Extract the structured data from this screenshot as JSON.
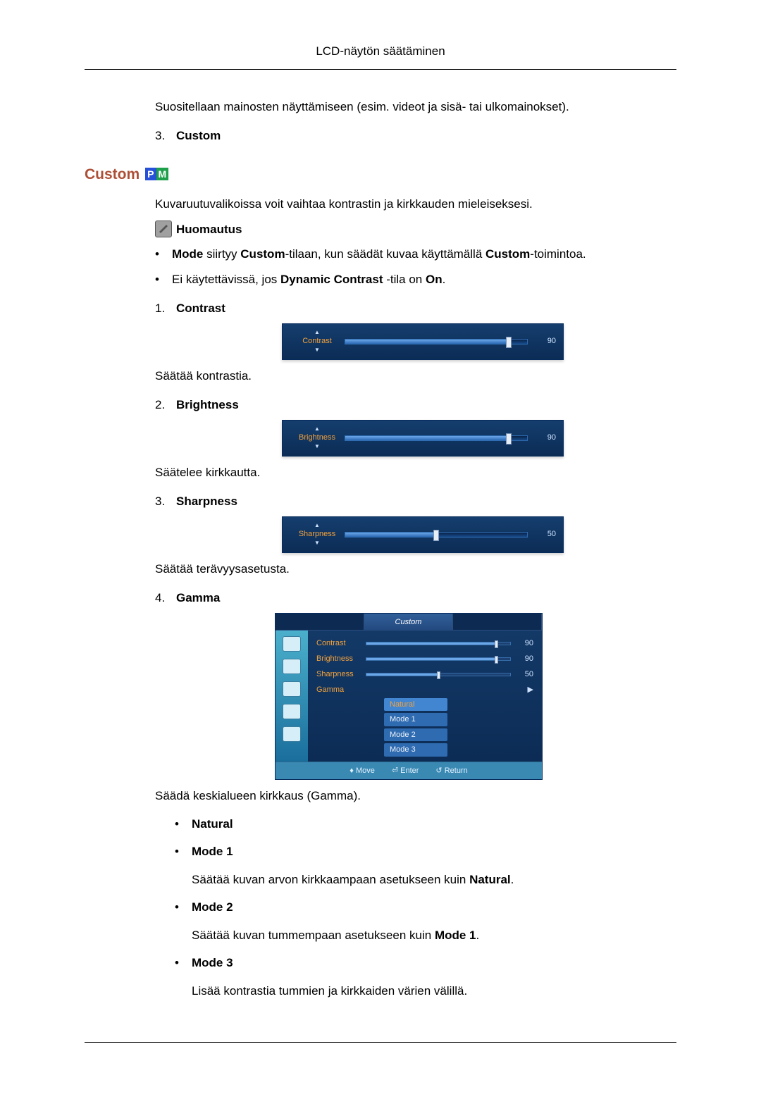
{
  "page_title": "LCD-näytön säätäminen",
  "intro_line": "Suositellaan mainosten näyttämiseen (esim. videot ja sisä- tai ulkomainokset).",
  "item3": {
    "num": "3.",
    "label": "Custom"
  },
  "custom_heading": "Custom",
  "pm": {
    "p": "P",
    "m": "M"
  },
  "custom_intro": "Kuvaruutuvalikoissa voit vaihtaa kontrastin ja kirkkauden mieleiseksesi.",
  "note_label": "Huomautus",
  "note_bullets": [
    {
      "pre": "Mode",
      "mid1": " siirtyy ",
      "b1": "Custom",
      "mid2": "-tilaan, kun säädät kuvaa käyttämällä ",
      "b2": "Custom",
      "post": "-toimintoa."
    },
    {
      "pre": "Ei käytettävissä, jos ",
      "b1": "Dynamic Contrast",
      "mid": " -tila on ",
      "b2": "On",
      "post": "."
    }
  ],
  "contrast": {
    "num": "1.",
    "label": "Contrast",
    "slider_label": "Contrast",
    "value": "90",
    "pct": 90,
    "desc": "Säätää kontrastia."
  },
  "brightness": {
    "num": "2.",
    "label": "Brightness",
    "slider_label": "Brightness",
    "value": "90",
    "pct": 90,
    "desc": "Säätelee kirkkautta."
  },
  "sharpness": {
    "num": "3.",
    "label": "Sharpness",
    "slider_label": "Sharpness",
    "value": "50",
    "pct": 50,
    "desc": "Säätää terävyysasetusta."
  },
  "gamma": {
    "num": "4.",
    "label": "Gamma",
    "desc": "Säädä keskialueen kirkkaus (Gamma).",
    "tab_title": "Custom",
    "rows": {
      "contrast": {
        "lbl": "Contrast",
        "val": "90",
        "pct": 90
      },
      "brightness": {
        "lbl": "Brightness",
        "val": "90",
        "pct": 90
      },
      "sharpness": {
        "lbl": "Sharpness",
        "val": "50",
        "pct": 50
      },
      "gamma": {
        "lbl": "Gamma"
      }
    },
    "options": {
      "o0": "Natural",
      "o1": "Mode 1",
      "o2": "Mode 2",
      "o3": "Mode 3"
    },
    "footer": {
      "move": "Move",
      "enter": "Enter",
      "return": "Return"
    }
  },
  "gamma_modes": {
    "natural": "Natural",
    "mode1": {
      "label": "Mode 1",
      "desc_pre": "Säätää kuvan arvon kirkkaampaan asetukseen kuin ",
      "desc_b": "Natural",
      "desc_post": "."
    },
    "mode2": {
      "label": "Mode 2",
      "desc_pre": "Säätää kuvan tummempaan asetukseen kuin ",
      "desc_b": "Mode 1",
      "desc_post": "."
    },
    "mode3": {
      "label": "Mode 3",
      "desc": "Lisää kontrastia tummien ja kirkkaiden värien välillä."
    }
  }
}
